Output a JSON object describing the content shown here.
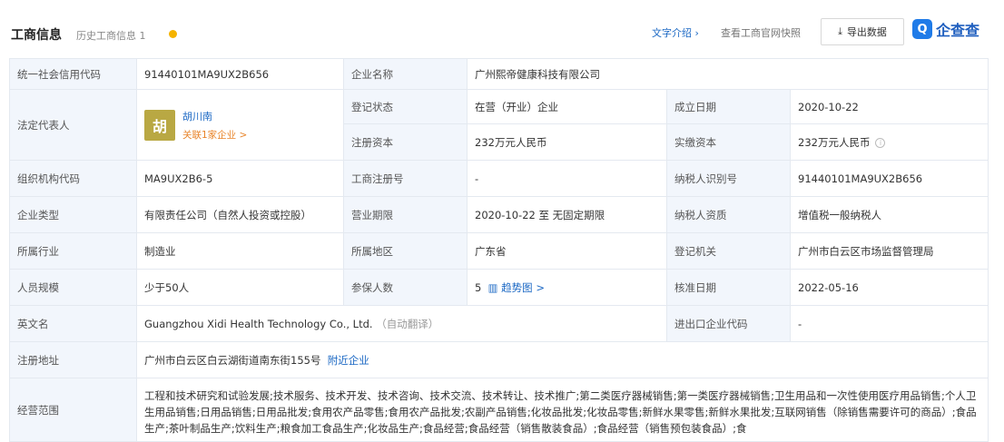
{
  "header": {
    "title": "工商信息",
    "history_label": "历史工商信息",
    "history_count": "1",
    "intro_link": "文字介绍",
    "official_link": "查看工商官网快照",
    "export_label": "导出数据",
    "brand_logo_char": "Q",
    "brand_name": "企查查"
  },
  "table": {
    "credit_code_label": "统一社会信用代码",
    "credit_code": "91440101MA9UX2B656",
    "company_name_label": "企业名称",
    "company_name": "广州熙帝健康科技有限公司",
    "legal_rep_label": "法定代表人",
    "legal_rep_avatar": "胡",
    "legal_rep_name": "胡川南",
    "legal_rep_assoc": "关联1家企业 >",
    "status_label": "登记状态",
    "status": "在营（开业）企业",
    "found_date_label": "成立日期",
    "found_date": "2020-10-22",
    "reg_capital_label": "注册资本",
    "reg_capital": "232万元人民币",
    "paid_capital_label": "实缴资本",
    "paid_capital": "232万元人民币",
    "org_code_label": "组织机构代码",
    "org_code": "MA9UX2B6-5",
    "biz_reg_no_label": "工商注册号",
    "biz_reg_no": "-",
    "taxpayer_id_label": "纳税人识别号",
    "taxpayer_id": "91440101MA9UX2B656",
    "company_type_label": "企业类型",
    "company_type": "有限责任公司（自然人投资或控股）",
    "biz_term_label": "营业期限",
    "biz_term": "2020-10-22 至 无固定期限",
    "taxpayer_qual_label": "纳税人资质",
    "taxpayer_qual": "增值税一般纳税人",
    "industry_label": "所属行业",
    "industry": "制造业",
    "region_label": "所属地区",
    "region": "广东省",
    "reg_authority_label": "登记机关",
    "reg_authority": "广州市白云区市场监督管理局",
    "staff_size_label": "人员规模",
    "staff_size": "少于50人",
    "insured_label": "参保人数",
    "insured": "5",
    "insured_trend": "趋势图 >",
    "approve_date_label": "核准日期",
    "approve_date": "2022-05-16",
    "english_name_label": "英文名",
    "english_name": "Guangzhou Xidi Health Technology Co., Ltd.",
    "english_name_note": "（自动翻译）",
    "import_export_label": "进出口企业代码",
    "import_export": "-",
    "reg_address_label": "注册地址",
    "reg_address": "广州市白云区白云湖街道南东街155号",
    "nearby_link": "附近企业",
    "scope_label": "经营范围",
    "scope": "工程和技术研究和试验发展;技术服务、技术开发、技术咨询、技术交流、技术转让、技术推广;第二类医疗器械销售;第一类医疗器械销售;卫生用品和一次性使用医疗用品销售;个人卫生用品销售;日用品销售;日用品批发;食用农产品零售;食用农产品批发;农副产品销售;化妆品批发;化妆品零售;新鲜水果零售;新鲜水果批发;互联网销售（除销售需要许可的商品）;食品生产;茶叶制品生产;饮料生产;粮食加工食品生产;化妆品生产;食品经营;食品经营（销售散装食品）;食品经营（销售预包装食品）;食"
  }
}
